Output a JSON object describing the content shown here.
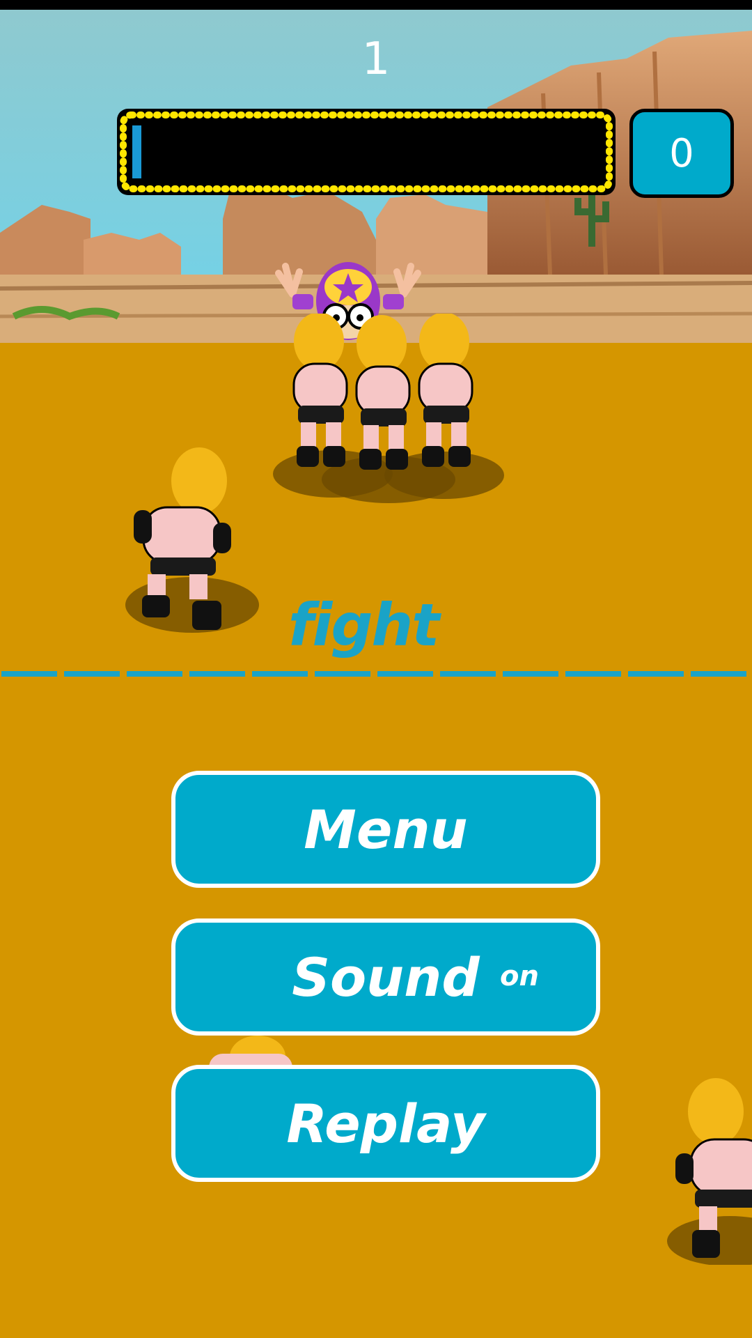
{
  "hud": {
    "level": "1",
    "power_level": 0.02,
    "score": "0"
  },
  "gameplay": {
    "word": "fight"
  },
  "menu": {
    "menu_label": "Menu",
    "sound_label": "Sound",
    "sound_state": "on",
    "replay_label": "Replay"
  },
  "colors": {
    "ground": "#d59600",
    "accent": "#00aacb",
    "border_lights": "#ffe600"
  }
}
